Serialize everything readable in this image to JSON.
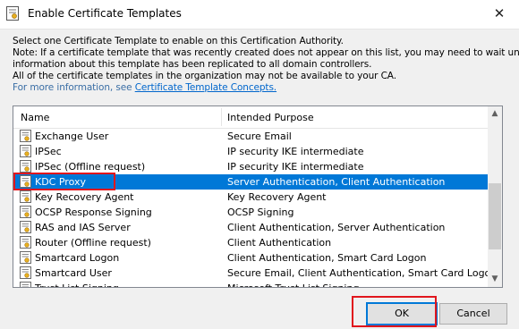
{
  "window": {
    "title": "Enable Certificate Templates",
    "close_glyph": "✕"
  },
  "description": {
    "line1": "Select one Certificate Template to enable on this Certification Authority.",
    "line2": "Note: If a certificate template that was recently created does not appear on this list, you may need to wait until",
    "line3": "information about this template has been replicated to all domain controllers.",
    "line4": "All of the certificate templates in the organization may not be available to your CA.",
    "more_prefix": "For more information, see ",
    "more_link": "Certificate Template Concepts."
  },
  "list": {
    "columns": {
      "name": "Name",
      "purpose": "Intended Purpose"
    },
    "rows": [
      {
        "name": "Exchange User",
        "purpose": "Secure Email"
      },
      {
        "name": "IPSec",
        "purpose": "IP security IKE intermediate"
      },
      {
        "name": "IPSec (Offline request)",
        "purpose": "IP security IKE intermediate"
      },
      {
        "name": "KDC Proxy",
        "purpose": "Server Authentication, Client Authentication",
        "selected": true
      },
      {
        "name": "Key Recovery Agent",
        "purpose": "Key Recovery Agent"
      },
      {
        "name": "OCSP Response Signing",
        "purpose": "OCSP Signing"
      },
      {
        "name": "RAS and IAS Server",
        "purpose": "Client Authentication, Server Authentication"
      },
      {
        "name": "Router (Offline request)",
        "purpose": "Client Authentication"
      },
      {
        "name": "Smartcard Logon",
        "purpose": "Client Authentication, Smart Card Logon"
      },
      {
        "name": "Smartcard User",
        "purpose": "Secure Email, Client Authentication, Smart Card Logon"
      },
      {
        "name": "Trust List Signing",
        "purpose": "Microsoft Trust List Signing"
      }
    ],
    "scroll_up_glyph": "▲",
    "scroll_down_glyph": "▼"
  },
  "buttons": {
    "ok": "OK",
    "cancel": "Cancel"
  },
  "colors": {
    "selection": "#0078d7",
    "highlight": "#e1161d",
    "link": "#0066cc"
  }
}
